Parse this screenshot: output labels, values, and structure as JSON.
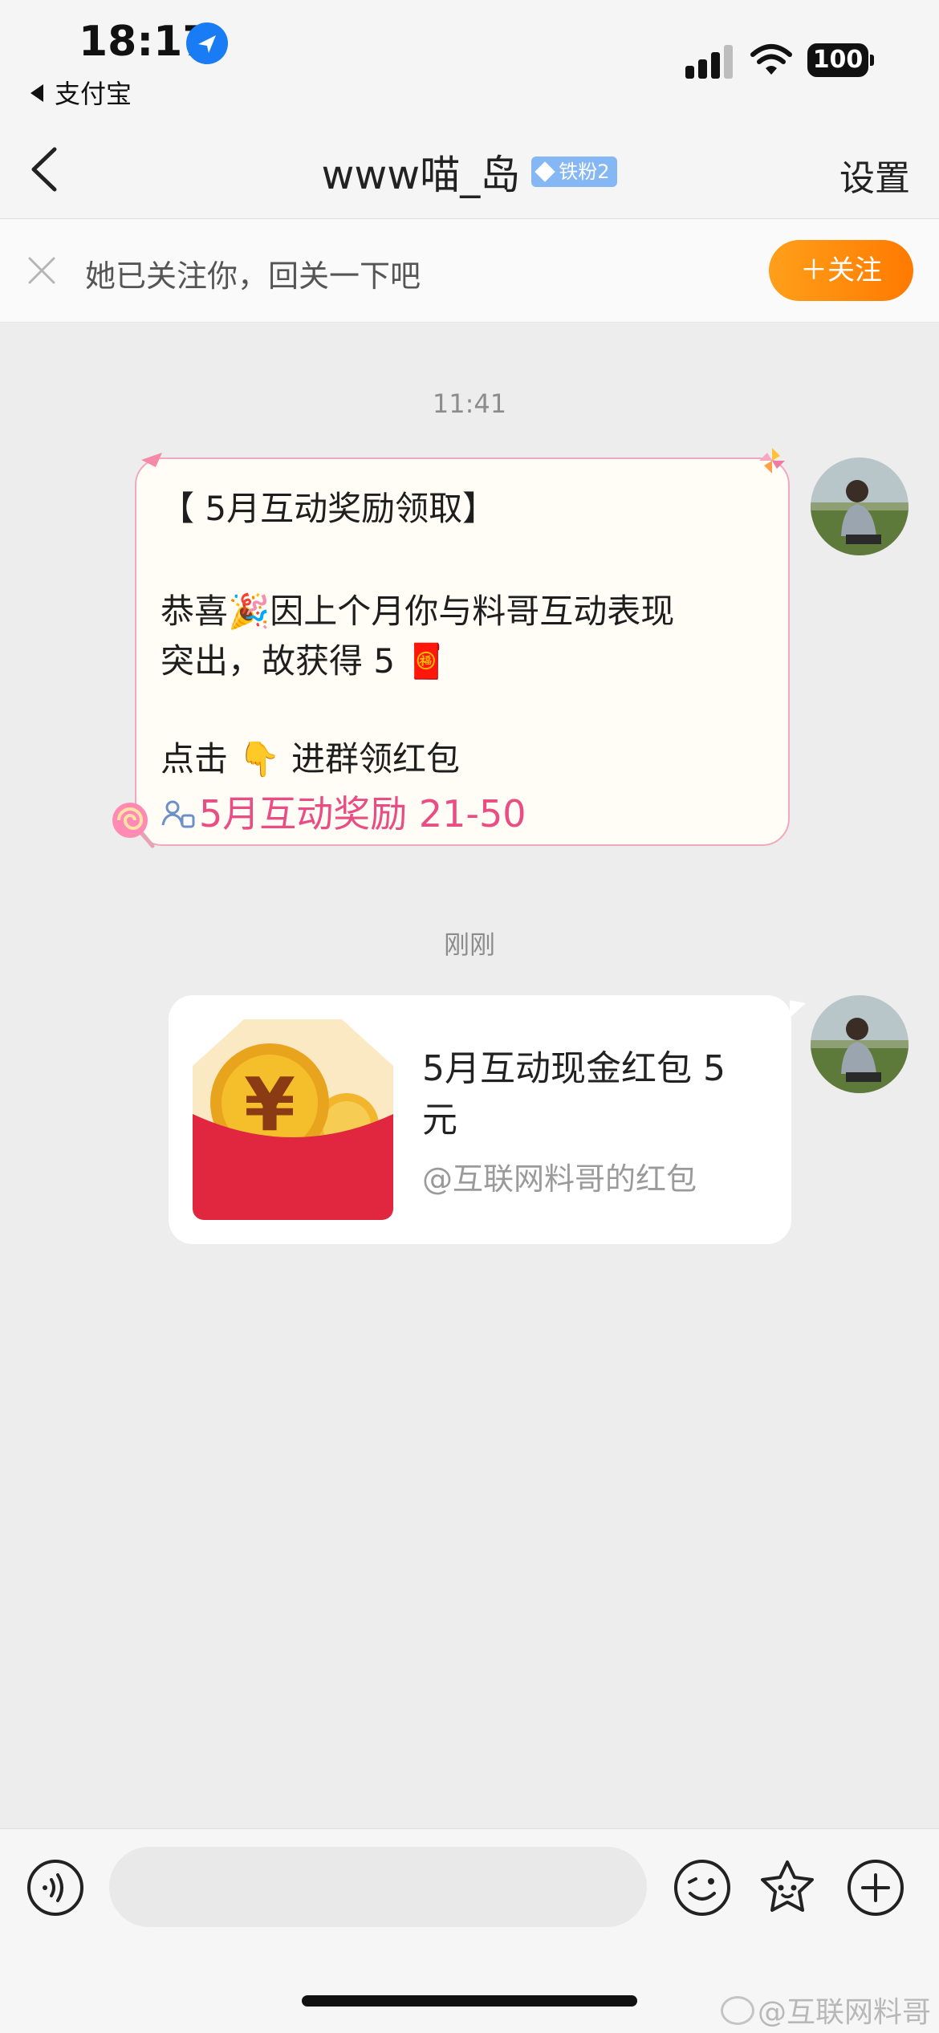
{
  "status_bar": {
    "time": "18:17",
    "back_app": "支付宝",
    "battery": "100"
  },
  "nav": {
    "title": "www喵_岛",
    "badge": "铁粉2",
    "settings": "设置"
  },
  "follow_banner": {
    "text": "她已关注你，回关一下吧",
    "button": "＋关注"
  },
  "messages": [
    {
      "time": "11:41",
      "lines": [
        "【 5月互动奖励领取】",
        "恭喜🎉因上个月你与料哥互动表现",
        "突出，故获得 5 🧧",
        "点击 👇 进群领红包"
      ],
      "link": "5月互动奖励 21-50"
    },
    {
      "time": "刚刚",
      "red_packet": {
        "title": "5月互动现金红包 5 元",
        "subtitle": "@互联网料哥的红包"
      }
    }
  ],
  "input_bar": {
    "placeholder": "",
    "icons": [
      "voice-icon",
      "emoji-icon",
      "sticker-icon",
      "plus-icon"
    ]
  },
  "watermark": "@互联网料哥",
  "colors": {
    "accent_orange": "#ff8a00",
    "link_pink": "#e94d84",
    "badge_blue": "#86b7f5",
    "card_border": "#f1a9bd"
  }
}
